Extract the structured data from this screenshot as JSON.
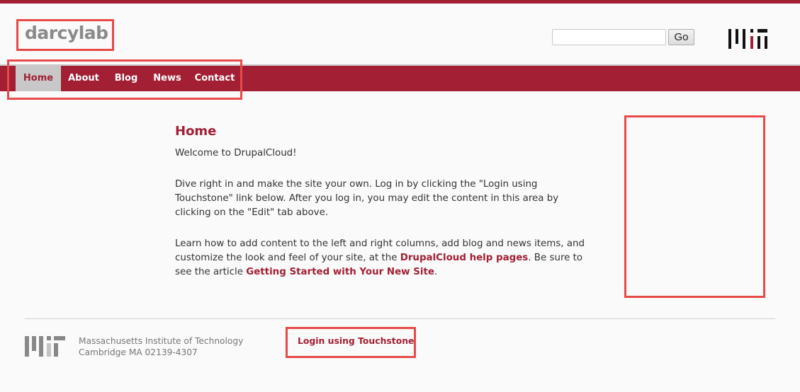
{
  "header": {
    "site_name": "darcylab",
    "search": {
      "value": "",
      "placeholder": ""
    },
    "go_label": "Go",
    "logo_icon": "mit-logo-icon"
  },
  "nav": {
    "items": [
      {
        "label": "Home",
        "active": true
      },
      {
        "label": "About",
        "active": false
      },
      {
        "label": "Blog",
        "active": false
      },
      {
        "label": "News",
        "active": false
      },
      {
        "label": "Contact",
        "active": false
      }
    ]
  },
  "main": {
    "title": "Home",
    "welcome": "Welcome to DrupalCloud!",
    "para1": "Dive right in and make the site your own. Log in by clicking the \"Login using Touchstone\" link below. After you log in, you may edit the content in this area by clicking on the \"Edit\" tab above.",
    "para2_before": "Learn how to add content to the left and right columns, add blog and news items, and customize the look and feel of your site, at the ",
    "para2_link1": "DrupalCloud help pages",
    "para2_middle": ". Be sure to see the article ",
    "para2_link2": "Getting Started with Your New Site",
    "para2_after": "."
  },
  "footer": {
    "address_line1": "Massachusetts Institute of Technology",
    "address_line2": "Cambridge MA 02139-4307",
    "login_label": "Login using Touchstone"
  },
  "colors": {
    "brand": "#a31f34",
    "nav_active_bg": "#c8c8c8",
    "highlight_outline": "#e84a47"
  }
}
